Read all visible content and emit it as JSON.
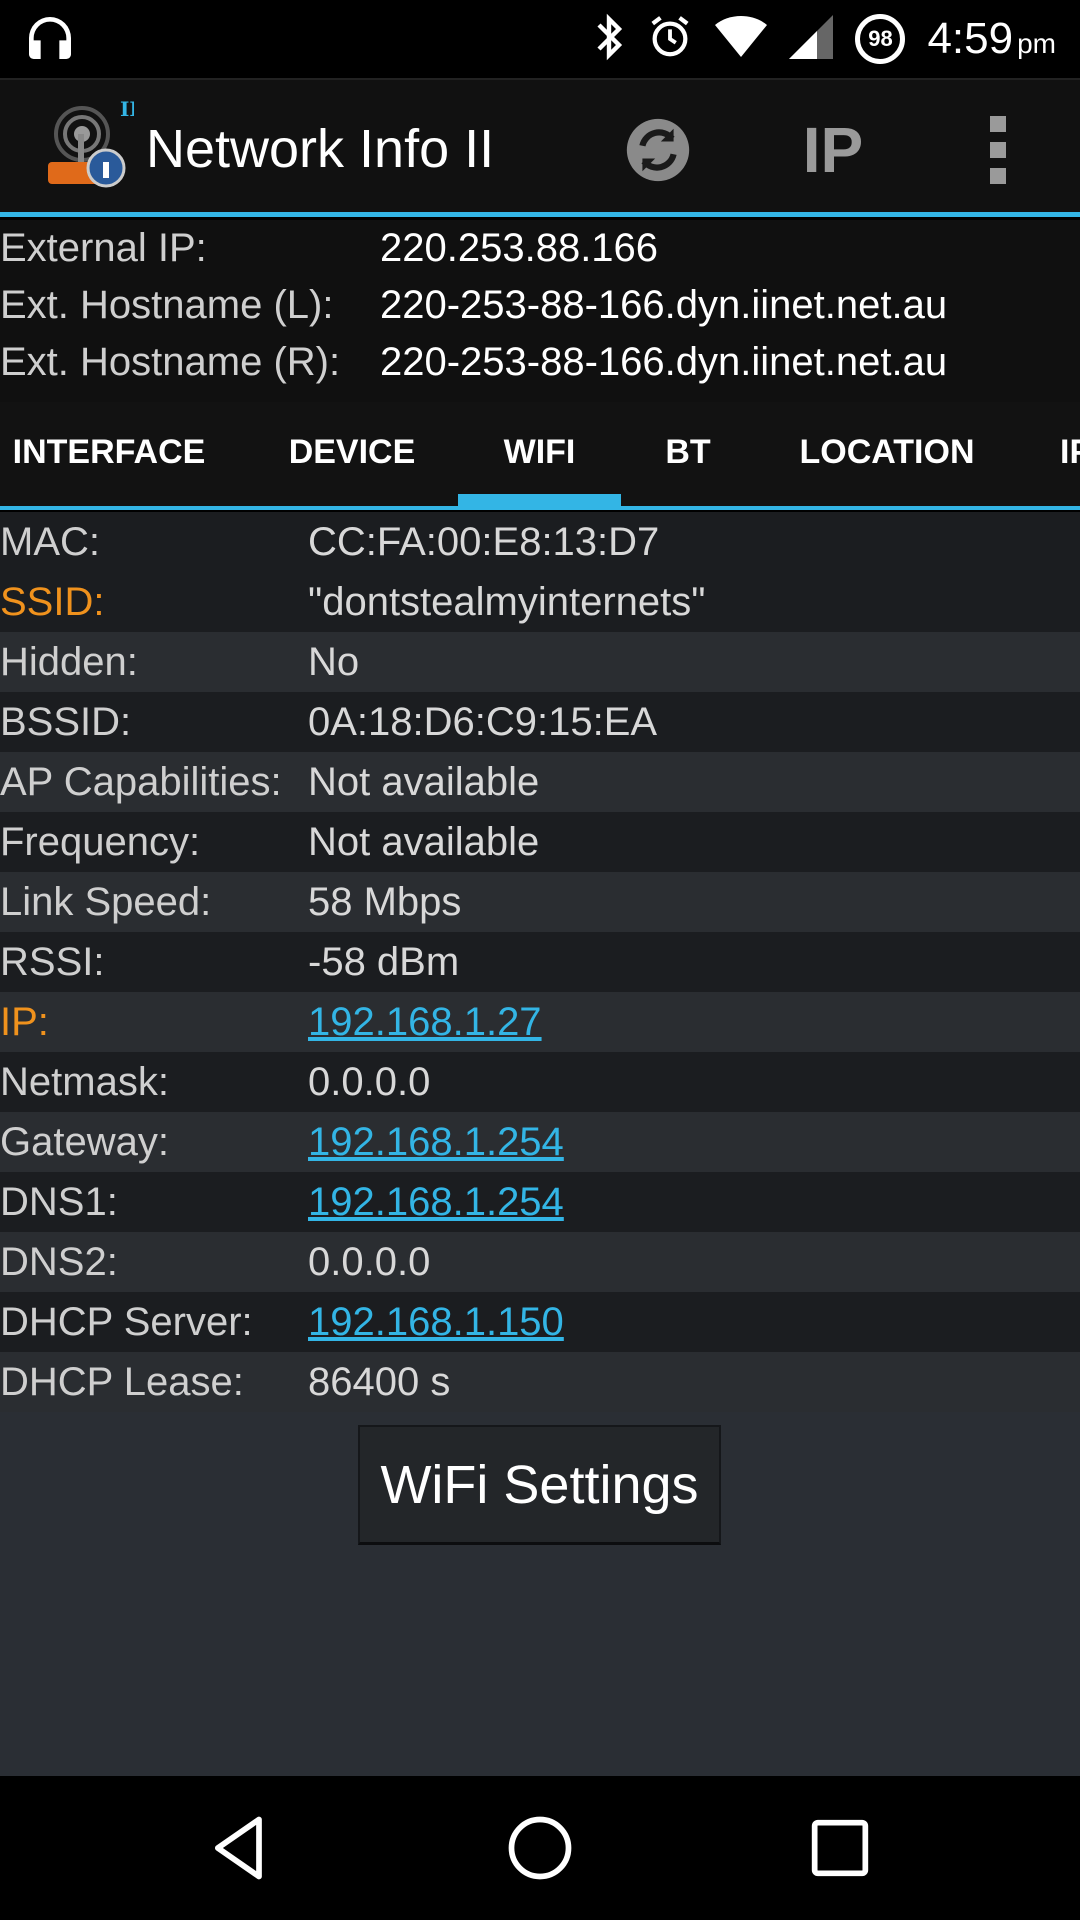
{
  "status_bar": {
    "time": "4:59",
    "ampm": "pm",
    "battery": "98",
    "icons": [
      "headphones-icon",
      "bluetooth-icon",
      "alarm-icon",
      "wifi-icon",
      "signal-icon"
    ]
  },
  "app_bar": {
    "title": "Network Info II",
    "ip_label": "IP",
    "actions": [
      "refresh-icon",
      "ip-icon",
      "overflow-menu-icon"
    ]
  },
  "external": [
    {
      "label": "External IP:",
      "value": "220.253.88.166"
    },
    {
      "label": "Ext. Hostname (L):",
      "value": "220-253-88-166.dyn.iinet.net.au"
    },
    {
      "label": "Ext. Hostname (R):",
      "value": "220-253-88-166.dyn.iinet.net.au"
    }
  ],
  "tabs": [
    "INTERFACE",
    "DEVICE",
    "WIFI",
    "BT",
    "LOCATION",
    "IP"
  ],
  "active_tab": "WIFI",
  "wifi": [
    {
      "label": "MAC:",
      "value": "CC:FA:00:E8:13:D7"
    },
    {
      "label": "SSID:",
      "value": "\"dontstealmyinternets\""
    },
    {
      "label": "Hidden:",
      "value": "No"
    },
    {
      "label": "BSSID:",
      "value": "0A:18:D6:C9:15:EA"
    },
    {
      "label": "AP Capabilities:",
      "value": "Not available"
    },
    {
      "label": "Frequency:",
      "value": "Not available"
    },
    {
      "label": "Link Speed:",
      "value": "58 Mbps"
    },
    {
      "label": "RSSI:",
      "value": "-58 dBm"
    },
    {
      "label": "IP:",
      "value": "192.168.1.27"
    },
    {
      "label": "Netmask:",
      "value": "0.0.0.0"
    },
    {
      "label": "Gateway:",
      "value": "192.168.1.254"
    },
    {
      "label": "DNS1:",
      "value": "192.168.1.254"
    },
    {
      "label": "DNS2:",
      "value": "0.0.0.0"
    },
    {
      "label": "DHCP Server:",
      "value": "192.168.1.150"
    },
    {
      "label": "DHCP Lease:",
      "value": "86400 s"
    }
  ],
  "wifi_settings_button": "WiFi Settings",
  "colors": {
    "accent": "#33b5e5",
    "highlight_label": "#f0921d",
    "background": "#2a2e34"
  },
  "nav_bar": [
    "back-icon",
    "home-icon",
    "recents-icon"
  ]
}
